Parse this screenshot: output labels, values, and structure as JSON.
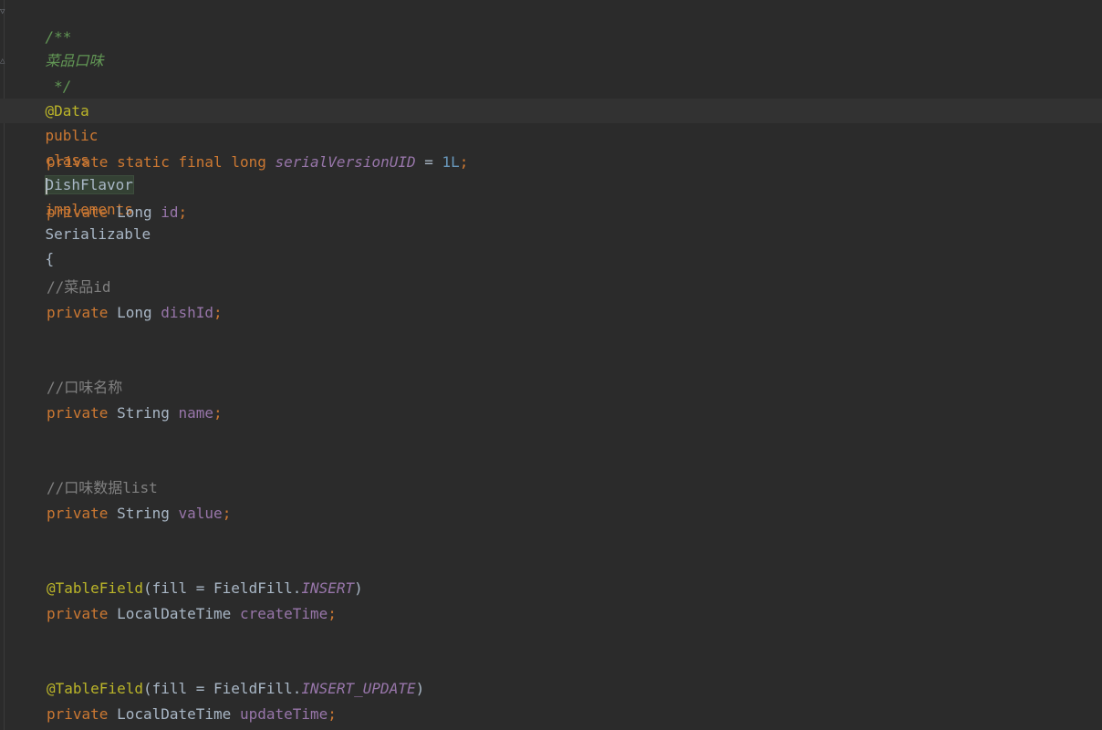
{
  "code": {
    "doc_open": "/**",
    "doc_text": "菜品口味",
    "doc_close": " */",
    "annotation_data": "@Data",
    "class_decl": {
      "modifier": "public",
      "class_kw": "class",
      "class_name": "DishFlavor",
      "implements_kw": "implements",
      "interface": "Serializable",
      "brace": "{"
    },
    "serial_line": {
      "private": "private",
      "static": "static",
      "final": "final",
      "type": "long",
      "name": "serialVersionUID",
      "eq": " = ",
      "value": "1L",
      "semi": ";"
    },
    "fields": [
      {
        "comment": "",
        "private": "private",
        "type": "Long",
        "name": "id",
        "semi": ";"
      },
      {
        "comment": "//菜品id",
        "private": "private",
        "type": "Long",
        "name": "dishId",
        "semi": ";"
      },
      {
        "comment": "//口味名称",
        "private": "private",
        "type": "String",
        "name": "name",
        "semi": ";"
      },
      {
        "comment": "//口味数据list",
        "private": "private",
        "type": "String",
        "name": "value",
        "semi": ";"
      }
    ],
    "table_fields": [
      {
        "annotation": "@TableField",
        "args_open": "(fill = FieldFill.",
        "enum_value": "INSERT",
        "args_close": ")",
        "private": "private",
        "type": "LocalDateTime",
        "name": "createTime",
        "semi": ";"
      },
      {
        "annotation": "@TableField",
        "args_open": "(fill = FieldFill.",
        "enum_value": "INSERT_UPDATE",
        "args_close": ")",
        "private": "private",
        "type": "LocalDateTime",
        "name": "updateTime",
        "semi": ";"
      }
    ]
  },
  "icons": {
    "fold_top": "fold-marker-icon",
    "fold_bottom": "fold-marker-icon"
  },
  "colors": {
    "background": "#2b2b2b",
    "keyword": "#cc7832",
    "annotation": "#bbb529",
    "doc_comment": "#629755",
    "line_comment": "#808080",
    "field": "#9876aa",
    "number": "#6897bb",
    "text": "#a9b7c6"
  }
}
